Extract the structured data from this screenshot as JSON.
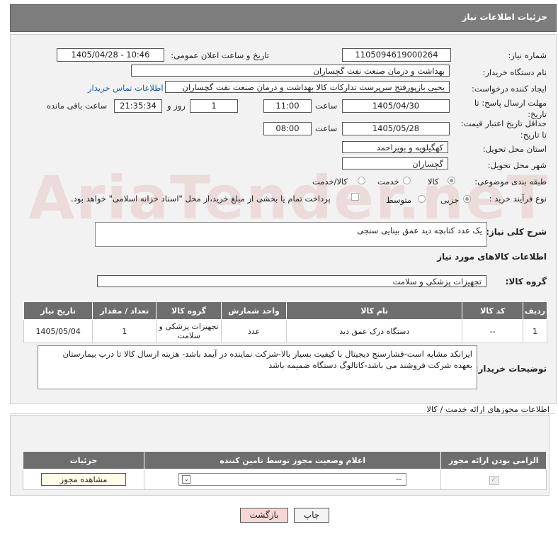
{
  "header": {
    "title": "جزئیات اطلاعات نیاز"
  },
  "fields": {
    "need_number_label": "شماره نیاز:",
    "need_number": "1105094619000264",
    "announce_label": "تاریخ و ساعت اعلان عمومی:",
    "announce_value": "1405/04/28 - 10:46",
    "buyer_label": "نام دستگاه خریدار:",
    "buyer_value": "بهداشت و درمان صنعت نفت گچساران",
    "creator_label": "ایجاد کننده درخواست:",
    "creator_value": "یحیی بازپورفتح سرپرست تدارکات کالا  بهداشت و درمان صنعت نفت گچساران",
    "contact_link": "اطلاعات تماس خریدار",
    "deadline_label": "مهلت ارسال پاسخ: تا تاریخ:",
    "deadline_date": "1405/04/30",
    "hour_label": "ساعت",
    "deadline_time": "11:00",
    "days_value": "1",
    "days_label": "روز و",
    "remaining_value": "21:35:34",
    "remaining_label": "ساعت باقی مانده",
    "validity_label": "حداقل تاریخ اعتبار قیمت: تا تاریخ:",
    "validity_date": "1405/05/28",
    "validity_time": "08:00",
    "province_label": "استان محل تحویل:",
    "province_value": "کهگیلویه و بویراحمد",
    "city_label": "شهر محل تحویل:",
    "city_value": "گچساران",
    "category_label": "طبقه بندی موضوعی:",
    "cat_goods": "کالا",
    "cat_service": "خدمت",
    "cat_both": "کالا/خدمت",
    "process_label": "نوع فرآیند خرید :",
    "proc_partial": "جزیی",
    "proc_medium": "متوسط",
    "payment_note": "پرداخت تمام یا بخشی از مبلغ خرید،از محل \"اسناد خزانه اسلامی\" خواهد بود."
  },
  "description": {
    "label": "شرح کلی نیاز:",
    "value": "یک عدد کتابچه دید عمق بینایی سنجی"
  },
  "goods_section": {
    "title": "اطلاعات کالاهای مورد نیاز",
    "group_label": "گروه کالا:",
    "group_value": "تجهیزات پزشکی و سلامت"
  },
  "table": {
    "headers": [
      "ردیف",
      "کد کالا",
      "نام کالا",
      "واحد شمارش",
      "گروه کالا",
      "تعداد / مقدار",
      "تاریخ نیاز"
    ],
    "rows": [
      [
        "1",
        "--",
        "دستگاه درک عمق دید",
        "عدد",
        "تجهیزات پزشکی و سلامت",
        "1",
        "1405/05/04"
      ]
    ]
  },
  "buyer_notes": {
    "label": "توضیحات خریدار:",
    "value": "ایرانکد مشابه است-فشارسنج دیجیتال با کیفیت بسیار بالا-شرکت نماینده در آیمد باشد- هزینه ارسال کالا تا درب بیمارستان بعهده شرکت فروشند می باشد-کاتالوگ دستگاه ضمیمه باشد"
  },
  "permits": {
    "title": "اطلاعات مجوزهای ارائه خدمت / کالا",
    "headers": [
      "الزامی بودن ارائه مجوز",
      "اعلام وضعیت مجوز توسط تامین کننده",
      "جزئیات"
    ],
    "select_value": "--",
    "view_button": "مشاهده مجوز"
  },
  "buttons": {
    "print": "چاپ",
    "back": "بازگشت"
  },
  "watermark": "AriaTender.neT",
  "colors": {
    "header": "#7d7d7d",
    "link": "#1a5fb4",
    "back_button": "#f7d6d6",
    "print_button": "#f4f4f4"
  }
}
